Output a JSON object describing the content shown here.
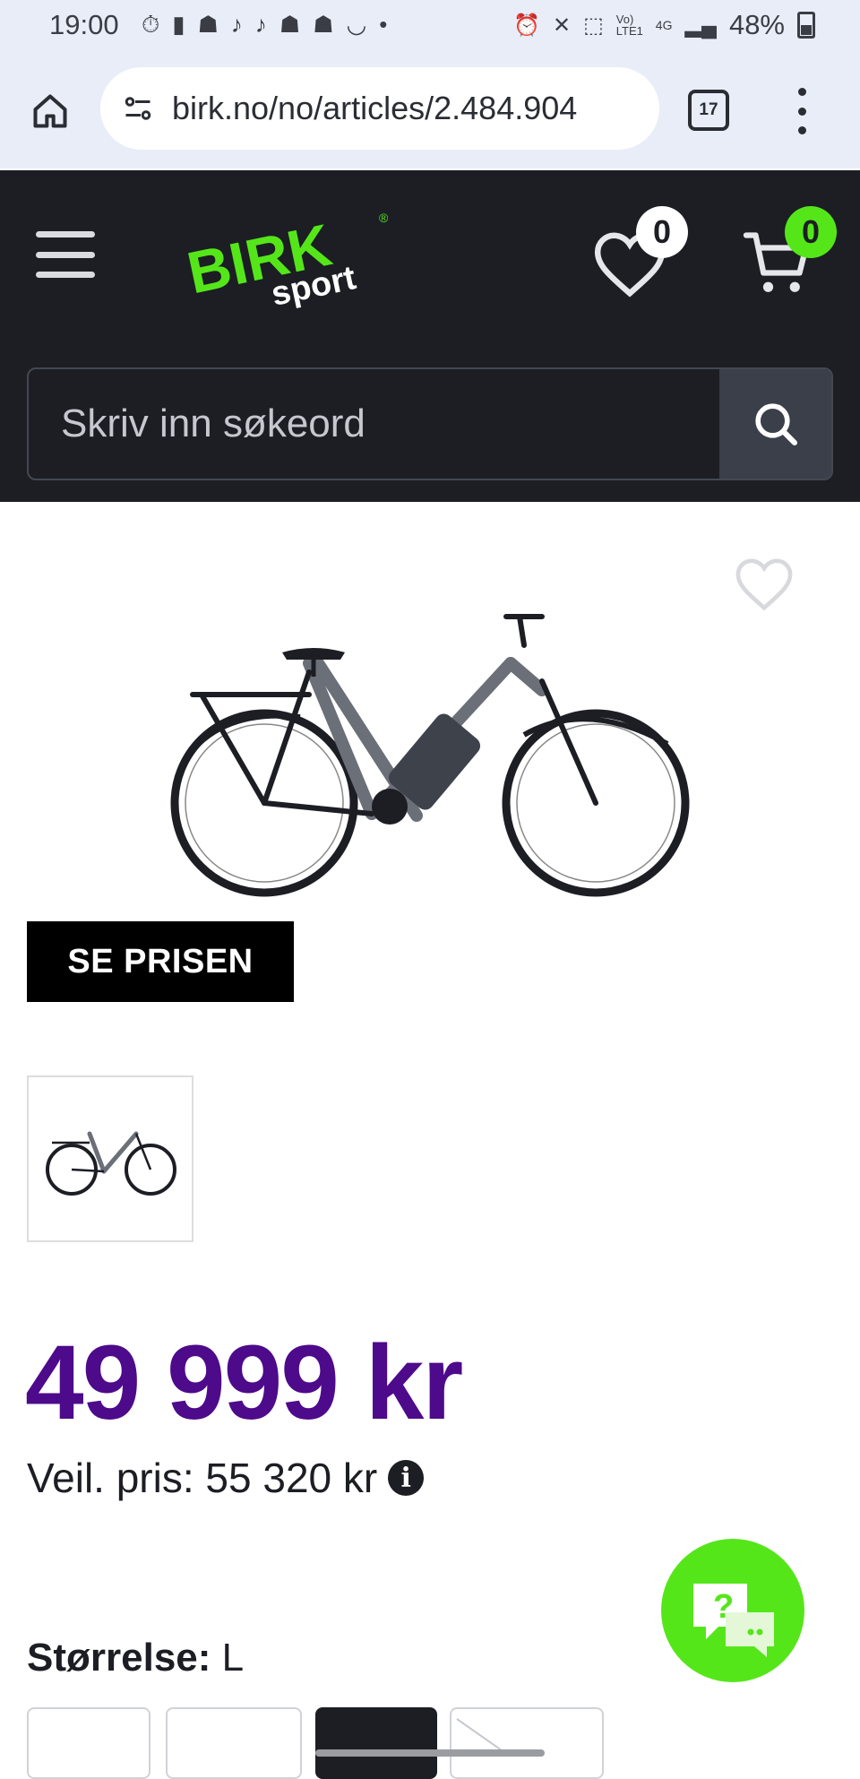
{
  "status_bar": {
    "time": "19:00",
    "network": "Vo) LTE1",
    "network_gen": "4G",
    "battery": "48%"
  },
  "browser": {
    "url": "birk.no/no/articles/2.484.904",
    "tab_count": "17"
  },
  "header": {
    "logo_text": "BIRK",
    "logo_sub": "sport",
    "wishlist_count": "0",
    "cart_count": "0",
    "search_placeholder": "Skriv inn søkeord"
  },
  "product": {
    "price": "49 999 kr",
    "rrp_label": "Veil. pris: 55 320 kr",
    "cta_label": "SE PRISEN",
    "size_label": "Størrelse:",
    "size_value": "L"
  },
  "colors": {
    "header_bg": "#1c1e24",
    "brand_green": "#55e61a",
    "price_purple": "#4d0a8a"
  }
}
